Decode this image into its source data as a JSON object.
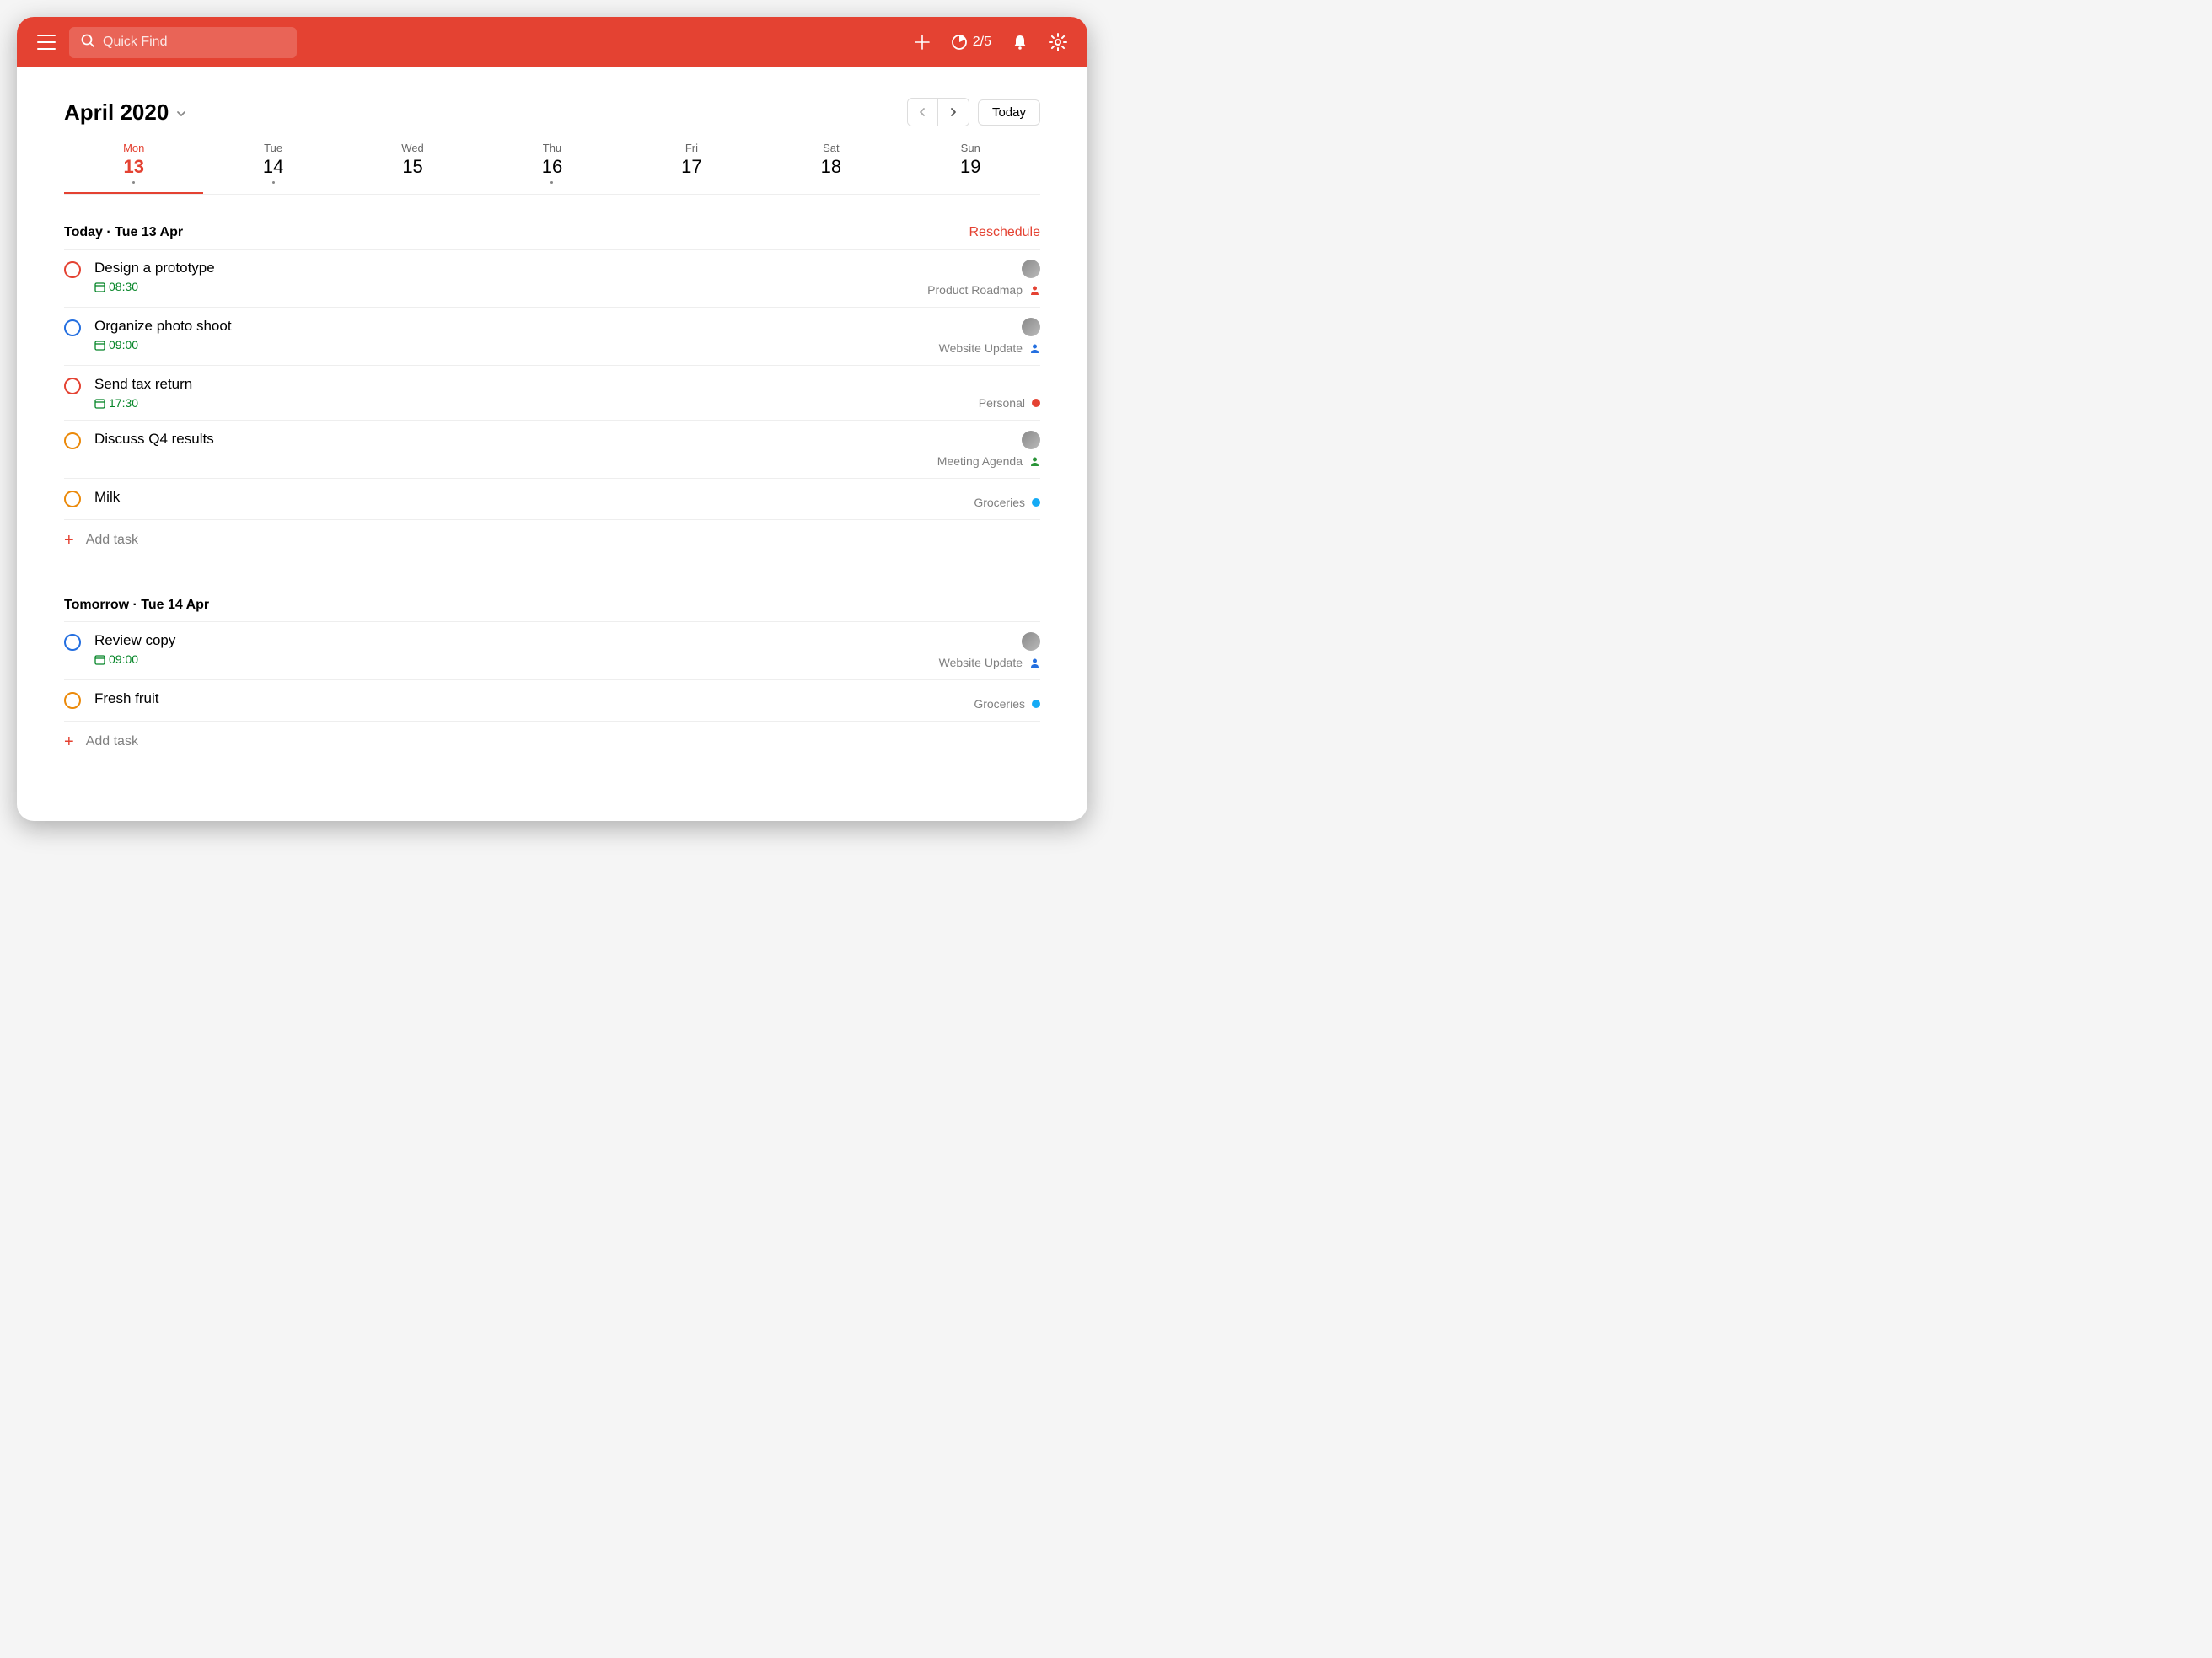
{
  "header": {
    "search_placeholder": "Quick Find",
    "productivity": "2/5"
  },
  "month_title": "April 2020",
  "today_label": "Today",
  "week": [
    {
      "name": "Mon",
      "num": "13",
      "active": true,
      "dot": true
    },
    {
      "name": "Tue",
      "num": "14",
      "active": false,
      "dot": true
    },
    {
      "name": "Wed",
      "num": "15",
      "active": false,
      "dot": false
    },
    {
      "name": "Thu",
      "num": "16",
      "active": false,
      "dot": true
    },
    {
      "name": "Fri",
      "num": "17",
      "active": false,
      "dot": false
    },
    {
      "name": "Sat",
      "num": "18",
      "active": false,
      "dot": false
    },
    {
      "name": "Sun",
      "num": "19",
      "active": false,
      "dot": false
    }
  ],
  "sections": [
    {
      "label": "Today",
      "sub": "Tue 13 Apr",
      "reschedule": "Reschedule",
      "tasks": [
        {
          "title": "Design a prototype",
          "time": "08:30",
          "priority_color": "#E44232",
          "project": "Product Roadmap",
          "project_kind": "person",
          "project_color": "#E44232",
          "avatar": true
        },
        {
          "title": "Organize photo shoot",
          "time": "09:00",
          "priority_color": "#246fe0",
          "project": "Website Update",
          "project_kind": "person",
          "project_color": "#246fe0",
          "avatar": true
        },
        {
          "title": "Send tax return",
          "time": "17:30",
          "priority_color": "#E44232",
          "project": "Personal",
          "project_kind": "dot",
          "project_color": "#E44232",
          "avatar": false
        },
        {
          "title": "Discuss Q4 results",
          "time": "",
          "priority_color": "#eb8909",
          "project": "Meeting Agenda",
          "project_kind": "person",
          "project_color": "#299438",
          "avatar": true
        },
        {
          "title": "Milk",
          "time": "",
          "priority_color": "#eb8909",
          "project": "Groceries",
          "project_kind": "dot",
          "project_color": "#14aaf5",
          "avatar": false
        }
      ],
      "add_task": "Add task"
    },
    {
      "label": "Tomorrow",
      "sub": "Tue 14 Apr",
      "reschedule": "",
      "tasks": [
        {
          "title": "Review copy",
          "time": "09:00",
          "priority_color": "#246fe0",
          "project": "Website Update",
          "project_kind": "person",
          "project_color": "#246fe0",
          "avatar": true
        },
        {
          "title": "Fresh fruit",
          "time": "",
          "priority_color": "#eb8909",
          "project": "Groceries",
          "project_kind": "dot",
          "project_color": "#14aaf5",
          "avatar": false
        }
      ],
      "add_task": "Add task"
    }
  ]
}
